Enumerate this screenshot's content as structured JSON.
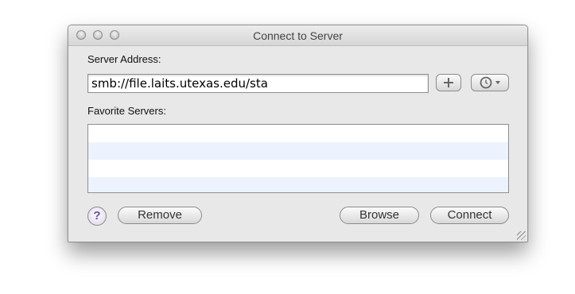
{
  "window": {
    "title": "Connect to Server"
  },
  "traffic_lights": [
    "close",
    "minimize",
    "zoom"
  ],
  "server_address": {
    "label": "Server Address:",
    "value": "smb://file.laits.utexas.edu/sta"
  },
  "add_button": {
    "icon": "plus-icon",
    "label": "+"
  },
  "recent_button": {
    "icon": "clock-icon",
    "dropdown": "triangle-down-icon"
  },
  "favorites": {
    "label": "Favorite Servers:",
    "rows": [
      "",
      "",
      "",
      ""
    ]
  },
  "buttons": {
    "help": "?",
    "remove": "Remove",
    "browse": "Browse",
    "connect": "Connect"
  },
  "colors": {
    "window_bg": "#e8e8e8",
    "alt_row": "#edf3fe",
    "help_glyph": "#6a4fa3"
  }
}
